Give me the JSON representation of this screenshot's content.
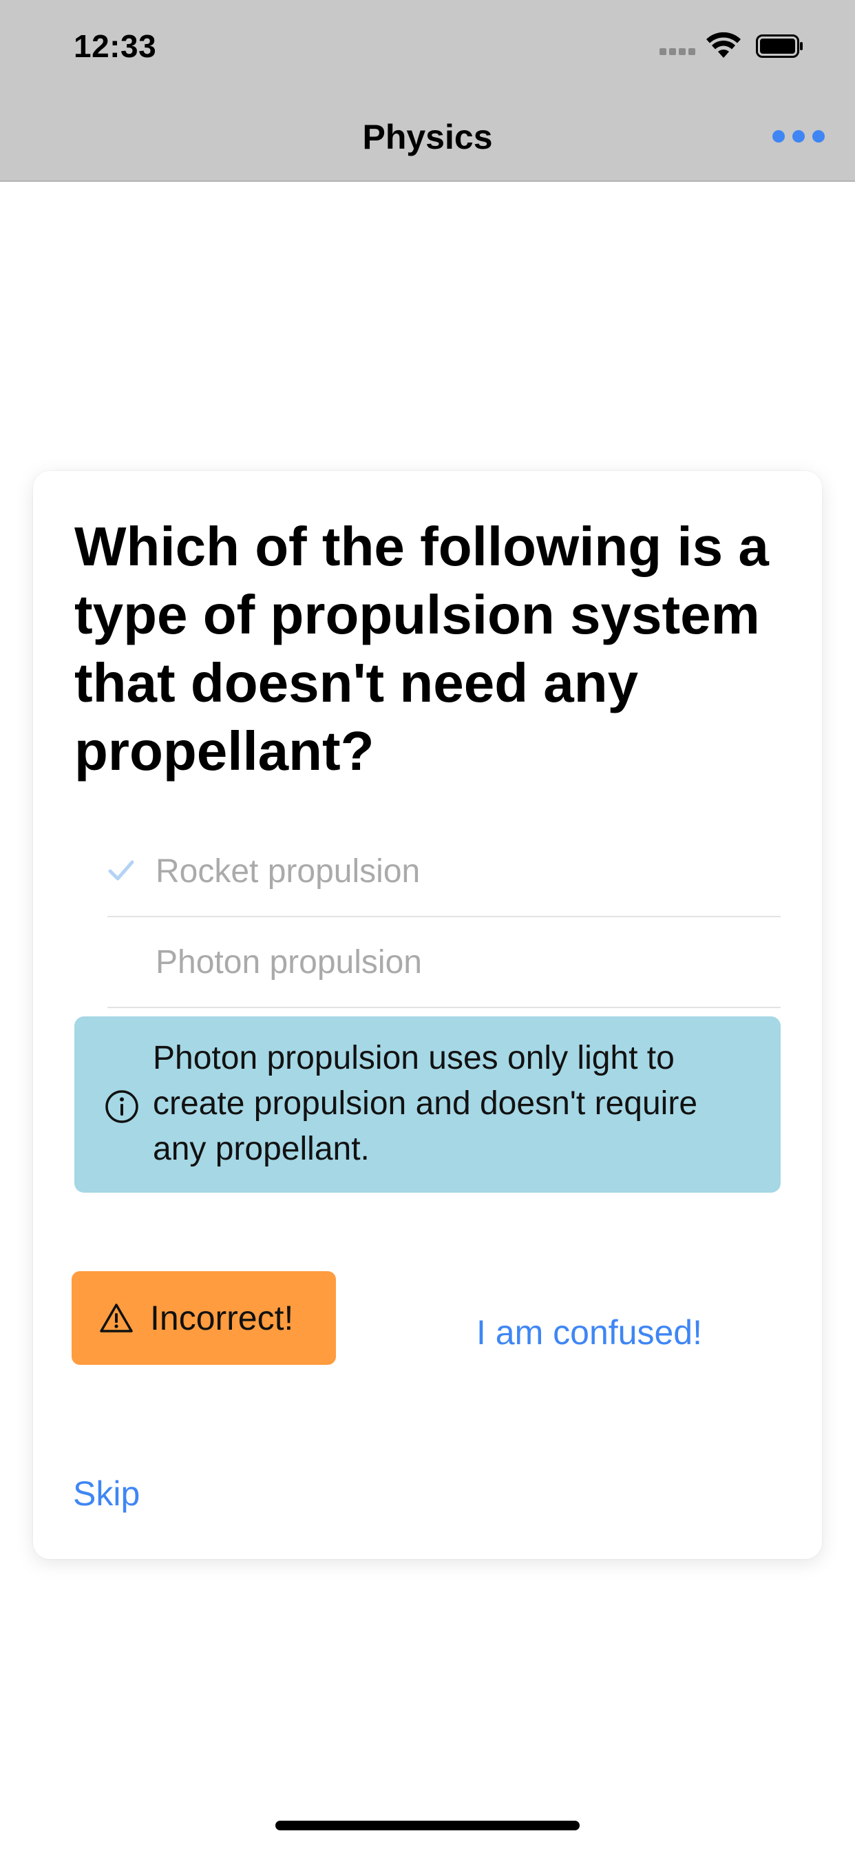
{
  "status_bar": {
    "time": "12:33"
  },
  "nav": {
    "title": "Physics",
    "more_icon": "ellipsis-icon",
    "accent_color": "#3f86f4"
  },
  "quiz": {
    "question": "Which of the following is a type of propulsion system that doesn't need any propellant?",
    "options": [
      {
        "label": "Rocket propulsion",
        "selected": true,
        "icon": "checkmark-icon"
      },
      {
        "label": "Photon propulsion",
        "selected": false
      }
    ],
    "explanation": {
      "icon": "info-circle-icon",
      "text": "Photon propulsion uses only light to create propulsion and doesn't require any propellant.",
      "background_color": "#a5d7e5"
    },
    "result": {
      "icon": "warning-triangle-icon",
      "label": "Incorrect!",
      "background_color": "#ff9c3f"
    },
    "confused_label": "I am confused!",
    "skip_label": "Skip"
  }
}
